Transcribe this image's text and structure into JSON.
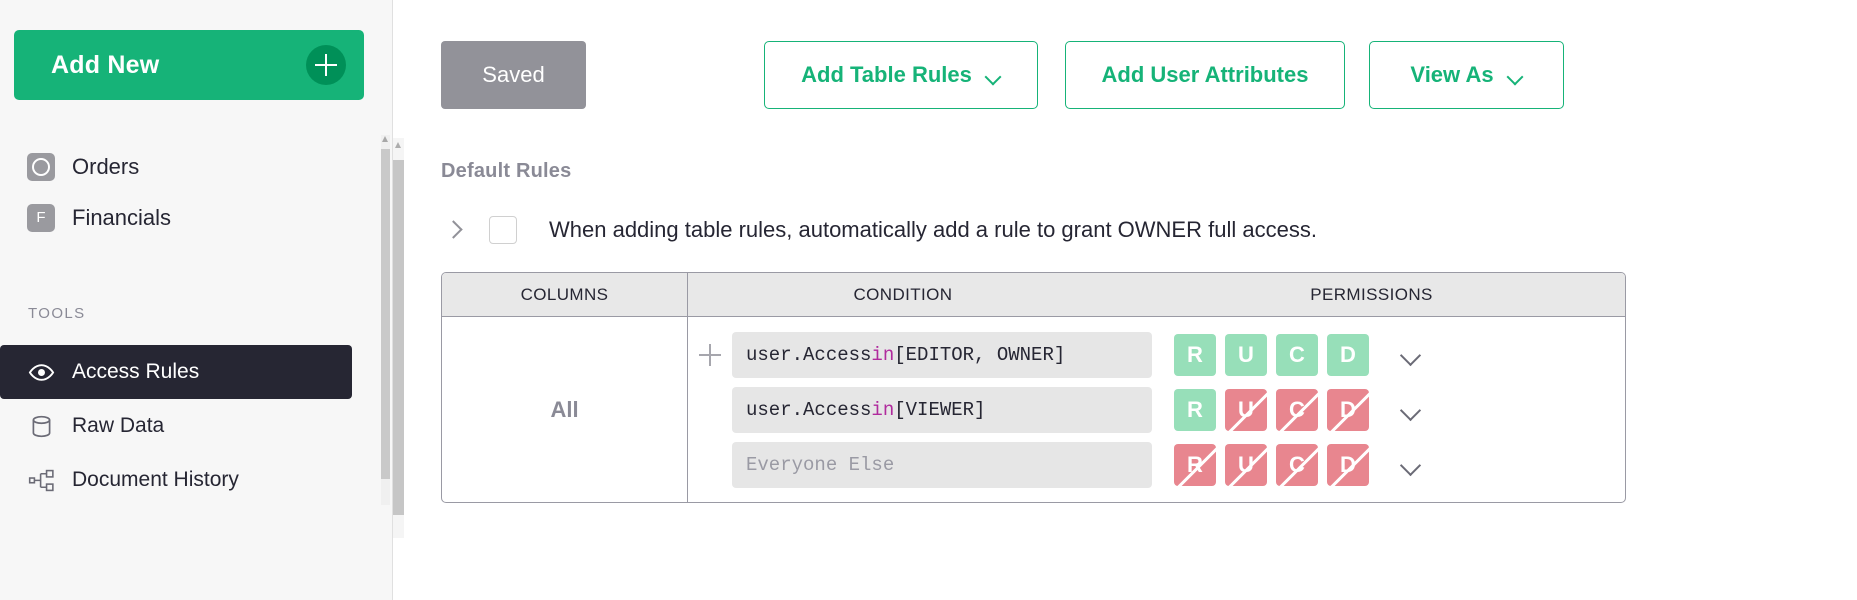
{
  "sidebar": {
    "add_new": {
      "label": "Add New",
      "icon": "plus-icon"
    },
    "pages": [
      {
        "label": "Orders",
        "badge": "O",
        "icon": "circle-doc-icon"
      },
      {
        "label": "Financials",
        "badge": "F",
        "icon": "letter-doc-icon"
      }
    ],
    "tools_header": "TOOLS",
    "tools": [
      {
        "label": "Access Rules",
        "icon": "eye-icon",
        "active": true
      },
      {
        "label": "Raw Data",
        "icon": "database-icon",
        "active": false
      },
      {
        "label": "Document History",
        "icon": "history-icon",
        "active": false
      }
    ]
  },
  "toolbar": {
    "saved_label": "Saved",
    "add_table_rules_label": "Add Table Rules",
    "add_user_attributes_label": "Add User Attributes",
    "view_as_label": "View As"
  },
  "main": {
    "section_title": "Default Rules",
    "default_rule_checkbox": {
      "checked": false,
      "text": "When adding table rules, automatically add a rule to grant OWNER full access."
    },
    "table": {
      "headers": [
        "COLUMNS",
        "CONDITION",
        "PERMISSIONS"
      ],
      "columns_value": "All",
      "rules": [
        {
          "condition": "user.Access in [EDITOR, OWNER]",
          "condition_prefix": "user.Access ",
          "condition_keyword": "in",
          "condition_suffix": " [EDITOR, OWNER]",
          "is_placeholder": false,
          "permissions": [
            {
              "letter": "R",
              "state": "allow"
            },
            {
              "letter": "U",
              "state": "allow"
            },
            {
              "letter": "C",
              "state": "allow"
            },
            {
              "letter": "D",
              "state": "allow"
            }
          ]
        },
        {
          "condition": "user.Access in [VIEWER]",
          "condition_prefix": "user.Access ",
          "condition_keyword": "in",
          "condition_suffix": " [VIEWER]",
          "is_placeholder": false,
          "permissions": [
            {
              "letter": "R",
              "state": "allow"
            },
            {
              "letter": "U",
              "state": "deny"
            },
            {
              "letter": "C",
              "state": "deny"
            },
            {
              "letter": "D",
              "state": "deny"
            }
          ]
        },
        {
          "condition": "Everyone Else",
          "condition_prefix": "Everyone Else",
          "condition_keyword": "",
          "condition_suffix": "",
          "is_placeholder": true,
          "permissions": [
            {
              "letter": "R",
              "state": "deny"
            },
            {
              "letter": "U",
              "state": "deny"
            },
            {
              "letter": "C",
              "state": "deny"
            },
            {
              "letter": "D",
              "state": "deny"
            }
          ]
        }
      ]
    }
  },
  "colors": {
    "brand_green": "#16b378",
    "allow_green": "#97dfb9",
    "deny_red": "#e8868f",
    "sidebar_bg": "#f7f7f7",
    "active_nav": "#262633",
    "saved_gray": "#929299"
  }
}
